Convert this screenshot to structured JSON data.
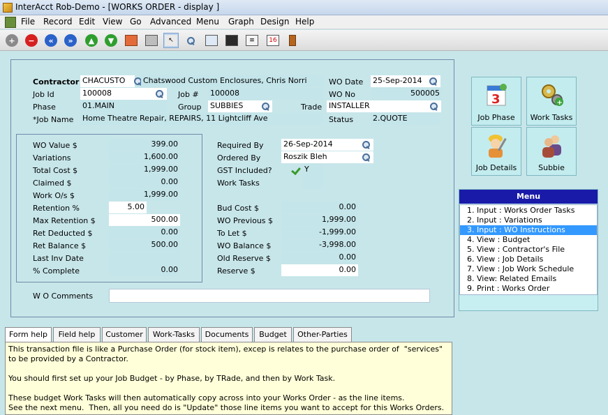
{
  "window": {
    "title": "InterAcct Rob-Demo - [WORKS ORDER - display ]"
  },
  "menubar": [
    "File",
    "Record",
    "Edit",
    "View",
    "Go",
    "Advanced",
    "Menu",
    "Graph",
    "Design",
    "Help"
  ],
  "header": {
    "contractor_label": "Contractor",
    "contractor_code": "CHACUSTO",
    "contractor_name": "Chatswood Custom Enclosures, Chris Norri",
    "wo_date_label": "WO Date",
    "wo_date": "25-Sep-2014",
    "job_id_label": "Job Id",
    "job_id": "100008",
    "job_no_label": "Job #",
    "job_no": "100008",
    "wo_no_label": "WO No",
    "wo_no": "500005",
    "phase_label": "Phase",
    "phase": "01.MAIN",
    "group_label": "Group",
    "group": "SUBBIES",
    "trade_label": "Trade",
    "trade": "INSTALLER",
    "job_name_label": "*Job Name",
    "job_name": "Home Theatre Repair, REPAIRS, 11 Lightcliff Ave",
    "status_label": "Status",
    "status": "2.QUOTE"
  },
  "values": {
    "wo_value_label": "WO Value  $",
    "wo_value": "399.00",
    "variations_label": "Variations",
    "variations": "1,600.00",
    "total_cost_label": "Total Cost  $",
    "total_cost": "1,999.00",
    "claimed_label": "Claimed   $",
    "claimed": "0.00",
    "work_os_label": "Work O/s   $",
    "work_os": "1,999.00",
    "retention_pct_label": "Retention %",
    "retention_pct": "5.00",
    "max_retention_label": "Max Retention $",
    "max_retention": "500.00",
    "ret_deducted_label": "Ret Deducted  $",
    "ret_deducted": "0.00",
    "ret_balance_label": "Ret Balance  $",
    "ret_balance": "500.00",
    "last_inv_date_label": "Last Inv Date",
    "pct_complete_label": "% Complete",
    "pct_complete": "0.00"
  },
  "details": {
    "required_by_label": "Required By",
    "required_by": "26-Sep-2014",
    "ordered_by_label": "Ordered By",
    "ordered_by": "Roszik Bleh",
    "gst_label": "GST Included?",
    "gst": "Y",
    "work_tasks_label": "Work Tasks"
  },
  "budget": {
    "bud_cost_label": "Bud Cost $",
    "bud_cost": "0.00",
    "wo_previous_label": "WO Previous $",
    "wo_previous": "1,999.00",
    "to_let_label": "To Let $",
    "to_let": "-1,999.00",
    "wo_balance_label": "WO Balance $",
    "wo_balance": "-3,998.00",
    "old_reserve_label": "Old Reserve $",
    "old_reserve": "0.00",
    "reserve_label": "Reserve $",
    "reserve": "0.00"
  },
  "comments": {
    "label": "W O Comments",
    "value": ""
  },
  "buttons": {
    "job_phase": "Job Phase",
    "work_tasks": "Work Tasks",
    "job_details": "Job Details",
    "subbie": "Subbie"
  },
  "menu": {
    "title": "Menu",
    "items": [
      "1. Input : Works Order Tasks",
      "2. Input : Variations",
      "3. Input : WO Instructions",
      "4. View : Budget",
      "5. View  : Contractor's File",
      "6. View  : Job Details",
      "7. View  : Job Work Schedule",
      "8. View: Related Emails",
      "9. Print : Works Order"
    ],
    "selected_index": 2
  },
  "tabs": [
    "Form help",
    "Field help",
    "Customer",
    "Work-Tasks",
    "Documents",
    "Budget",
    "Other-Parties"
  ],
  "help": {
    "p1": "This transaction file is like a Purchase Order (for stock item), excep is relates to the purchase order of  \"services\" to be provided by a Contractor.",
    "p2": "You should first set up your Job Budget - by Phase, by TRade, and then by Work Task.",
    "p3": "These budget Work Tasks will then automatically copy across into your Works Order - as the line items.\nSee the next menu.  Then, all you need do is \"Update\" those line items you want to accept for this Works Orders."
  },
  "colors": {
    "background": "#c7e6ea",
    "menu_header": "#1a1aa8",
    "menu_selected": "#3399ff",
    "help_bg": "#ffffd9"
  }
}
